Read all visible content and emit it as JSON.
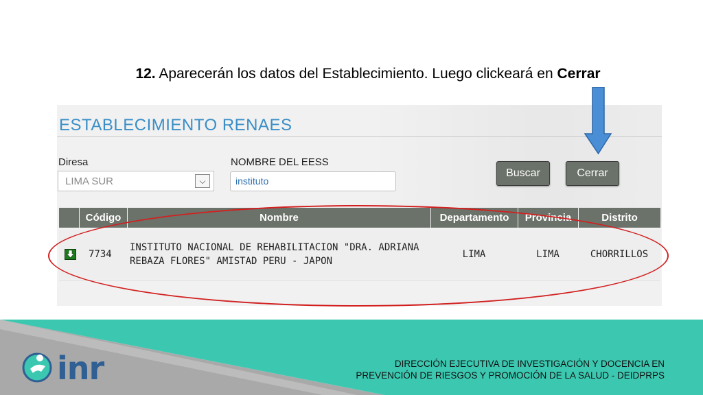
{
  "instruction": {
    "number": "12.",
    "text": " Aparecerán los datos del Establecimiento. Luego clickeará en ",
    "emphasis": "Cerrar"
  },
  "panel": {
    "title": "ESTABLECIMIENTO RENAES",
    "diresa_label": "Diresa",
    "diresa_value": "LIMA SUR",
    "eess_label": "NOMBRE DEL EESS",
    "eess_value": "instituto",
    "buscar_label": "Buscar",
    "cerrar_label": "Cerrar"
  },
  "table": {
    "columns": [
      "",
      "Código",
      "Nombre",
      "Departamento",
      "Provincia",
      "Distrito"
    ],
    "rows": [
      {
        "codigo": "7734",
        "nombre": "INSTITUTO NACIONAL DE REHABILITACION \"DRA. ADRIANA REBAZA FLORES\" AMISTAD PERU - JAPON",
        "departamento": "LIMA",
        "provincia": "LIMA",
        "distrito": "CHORRILLOS"
      }
    ]
  },
  "footer": {
    "logo_text": "inr",
    "line1": "DIRECCIÓN EJECUTIVA DE INVESTIGACIÓN Y DOCENCIA EN",
    "line2": "PREVENCIÓN DE RIESGOS Y PROMOCIÓN DE LA SALUD - DEIDPRPS"
  },
  "colors": {
    "title_blue": "#3a8ec7",
    "header_gray": "#6b7269",
    "highlight_red": "#d22020",
    "arrow_blue": "#4a8fd6",
    "footer_teal": "#3cc8b0",
    "footer_gray": "#a9a9a9"
  },
  "icons": [
    "download-icon",
    "chevron-down-icon",
    "arrow-down-icon"
  ]
}
